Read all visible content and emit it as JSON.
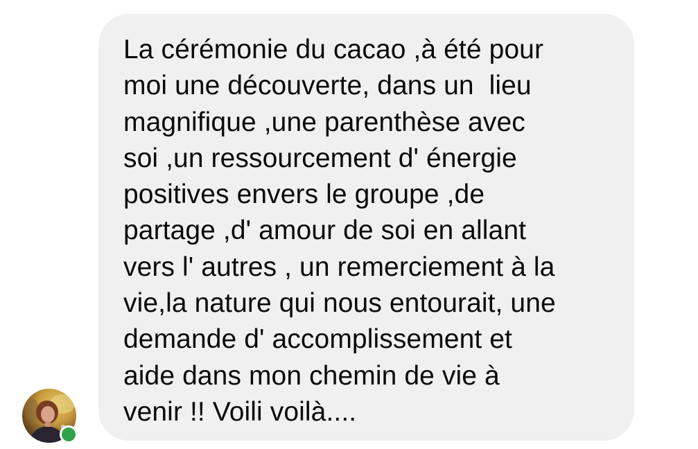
{
  "message": {
    "lines": [
      "La cérémonie du cacao ,à été pour",
      "moi une découverte, dans un  lieu",
      "magnifique ,une parenthèse avec",
      "soi ,un ressourcement d' énergie",
      "positives envers le groupe ,de",
      "partage ,d' amour de soi en allant",
      "vers l' autres , un remerciement à la",
      "vie,la nature qui nous entourait, une",
      "demande d' accomplissement et",
      "aide dans mon chemin de vie à",
      "venir !! Voili voilà...."
    ]
  },
  "sender": {
    "avatar_icon": "profile-photo",
    "online": true,
    "presence_color": "#31a24c"
  },
  "colors": {
    "bubble_background": "#f0f0f0",
    "text": "#0a0a0a",
    "page_background": "#ffffff"
  }
}
